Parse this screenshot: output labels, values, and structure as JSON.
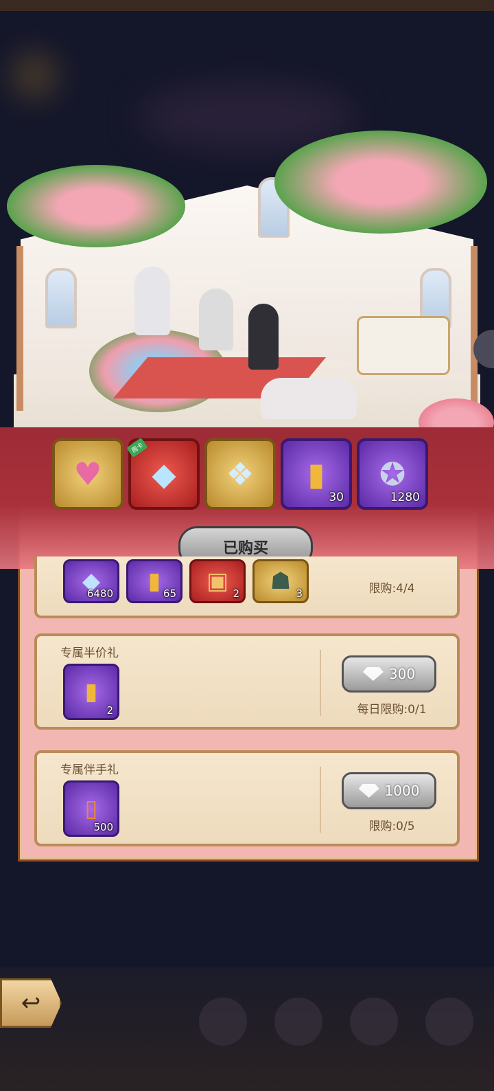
{
  "header_items": [
    {
      "name": "heart-gift-box",
      "qty": "",
      "frame": "gold",
      "icon": "heart-box-icon"
    },
    {
      "name": "weekly-card",
      "qty": "",
      "frame": "red",
      "icon": "crystal-card-icon",
      "tag": "周卡"
    },
    {
      "name": "diamond-pile",
      "qty": "",
      "frame": "gold",
      "icon": "diamond-pile-icon"
    },
    {
      "name": "bullet",
      "qty": "30",
      "frame": "purple",
      "icon": "bullet-icon"
    },
    {
      "name": "medal",
      "qty": "1280",
      "frame": "purple",
      "icon": "medal-icon"
    }
  ],
  "bought_label": "已购买",
  "cards": [
    {
      "title": "",
      "rewards": [
        {
          "icon": "diamond-icon",
          "qty": "6480",
          "frame": "purple"
        },
        {
          "icon": "bullet-icon",
          "qty": "65",
          "frame": "purple"
        },
        {
          "icon": "chest-icon",
          "qty": "2",
          "frame": "red"
        },
        {
          "icon": "amulet-icon",
          "qty": "3",
          "frame": "gold"
        }
      ],
      "price": "",
      "limit": "限购:4/4"
    },
    {
      "title": "专属半价礼",
      "rewards": [
        {
          "icon": "bullet-icon",
          "qty": "2",
          "frame": "purple"
        }
      ],
      "price": "300",
      "limit": "每日限购:0/1"
    },
    {
      "title": "专属伴手礼",
      "rewards": [
        {
          "icon": "battery-icon",
          "qty": "500",
          "frame": "purple"
        }
      ],
      "price": "1000",
      "limit": "限购:0/5"
    }
  ],
  "colors": {
    "panel_pink": "#f3b7b3",
    "ribbon_red": "#a9313b",
    "card_bg": "#f5e6cd",
    "text_brown": "#6b4f33"
  }
}
